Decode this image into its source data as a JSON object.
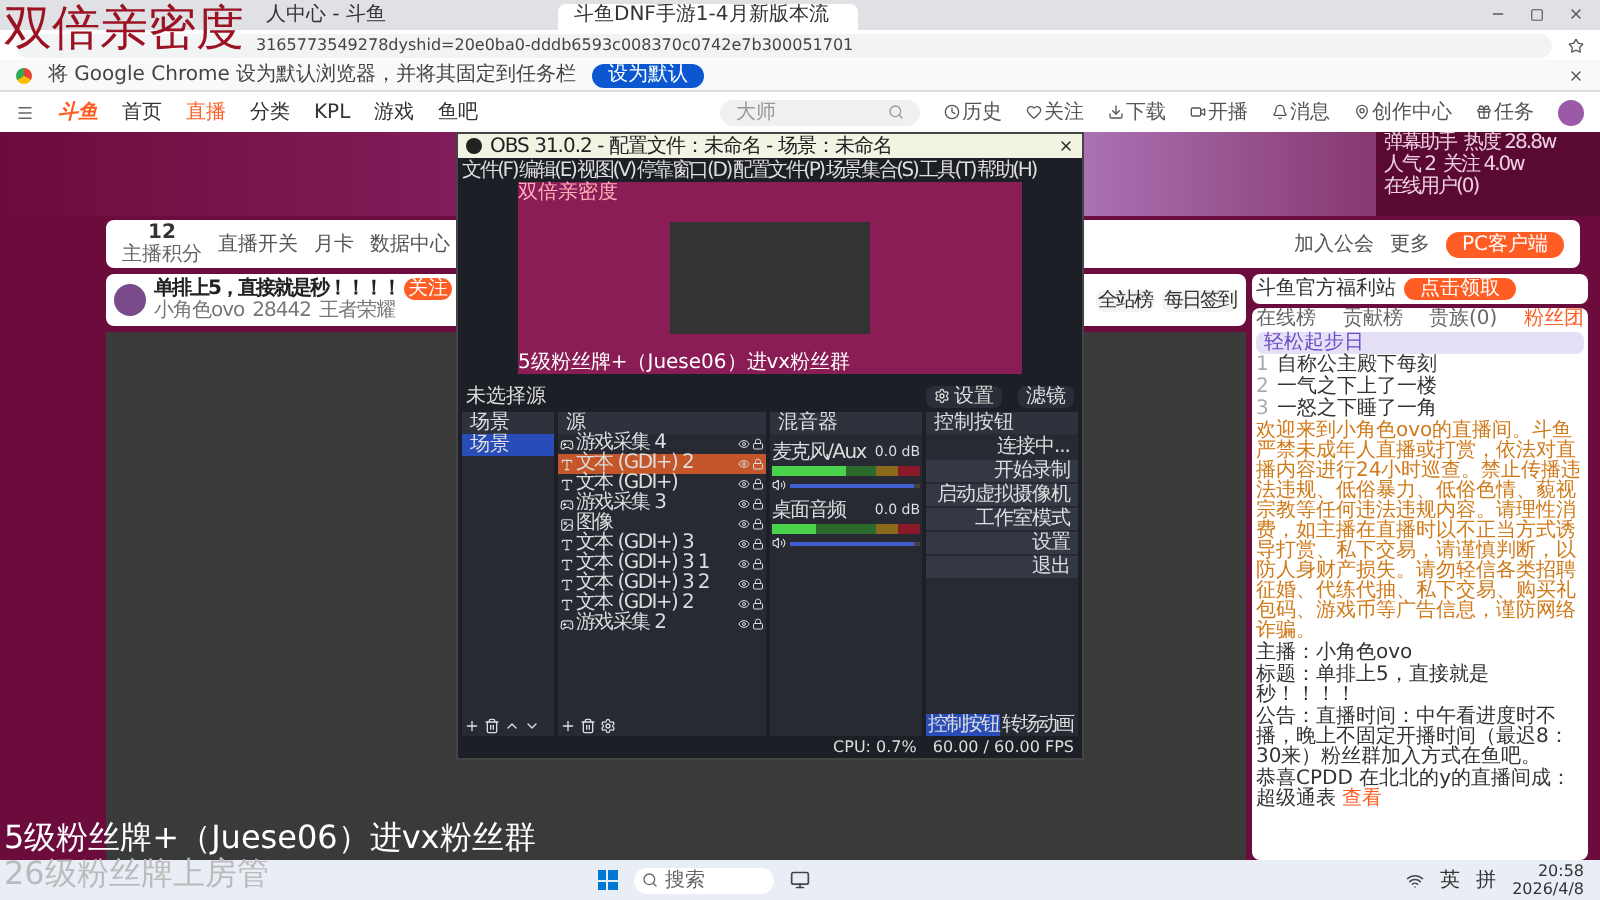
{
  "overlay": {
    "top_caption": "双倍亲密度",
    "bottom_caption": "5级粉丝牌+（Juese06）进vx粉丝群",
    "bottom_caption_2": "26级粉丝牌上房管"
  },
  "browser": {
    "tabs": [
      {
        "label": "人中心 - 斗鱼",
        "selected": false
      },
      {
        "label": "斗鱼DNF手游1-4月新版本流",
        "selected": true
      }
    ],
    "url": "3165773549278dyshid=20e0ba0-dddb6593c008370c0742e7b300051701",
    "infobar": {
      "text": "将 Google Chrome 设为默认浏览器，并将其固定到任务栏",
      "button": "设为默认"
    }
  },
  "site": {
    "logo": "斗鱼",
    "nav": [
      {
        "label": "首页",
        "selected": false
      },
      {
        "label": "直播",
        "selected": true
      },
      {
        "label": "分类",
        "selected": false
      },
      {
        "label": "KPL",
        "selected": false
      },
      {
        "label": "游戏",
        "selected": false
      },
      {
        "label": "鱼吧",
        "selected": false
      }
    ],
    "search": {
      "placeholder": "大师"
    },
    "header_icons": [
      {
        "label": "历史",
        "kind": "clock"
      },
      {
        "label": "关注",
        "kind": "heart"
      },
      {
        "label": "下载",
        "kind": "download"
      },
      {
        "label": "开播",
        "kind": "video"
      },
      {
        "label": "消息",
        "kind": "bell"
      },
      {
        "label": "创作中心",
        "kind": "pin"
      },
      {
        "label": "任务",
        "kind": "gift"
      }
    ]
  },
  "toolbar": {
    "points": "12",
    "points_label": "主播积分",
    "items_left": [
      "直播开关",
      "月卡",
      "数据中心"
    ],
    "items_right": [
      "加入公会",
      "更多"
    ],
    "pc_button": "PC客户端"
  },
  "room": {
    "title": "单排上5，直接就是秒！！！！",
    "follow": "关注",
    "streamer": "小角色ovo",
    "hot": "28442",
    "category": "王者荣耀",
    "rank_button": "全站榜",
    "checkin": "每日签到"
  },
  "promo": {
    "title": "斗鱼官方福利站",
    "button": "点击领取"
  },
  "chat": {
    "tabs": [
      {
        "label": "在线榜",
        "selected": false
      },
      {
        "label": "贡献榜",
        "selected": false
      },
      {
        "label": "贵族(0)",
        "selected": false
      },
      {
        "label": "粉丝团",
        "selected": true
      }
    ],
    "fan_badge": "轻松起步日",
    "ranks": [
      {
        "rank": "1",
        "name": "自称公主殿下每刻"
      },
      {
        "rank": "2",
        "name": "一气之下上了一楼"
      },
      {
        "rank": "3",
        "name": "一怒之下睡了一角"
      }
    ],
    "welcome": "欢迎来到小角色ovo的直播间。斗鱼严禁未成年人直播或打赏，依法对直播内容进行24小时巡查。禁止传播违法违规、低俗暴力、低俗色情、藐视宗教等任何违法违规内容。请理性消费，如主播在直播时以不正当方式诱导打赏、私下交易，请谨慎判断，以防人身财产损失。请勿轻信各类招聘征婚、代练代抽、私下交易、购买礼包码、游戏币等广告信息，谨防网络诈骗。",
    "info": [
      {
        "key": "主播：",
        "value": "小角色ovo"
      },
      {
        "key": "标题：",
        "value": "单排上5，直接就是秒！！！！"
      },
      {
        "key": "公告：",
        "value": "直播时间：中午看进度时不播，晚上不固定开播时间（最迟8：30来）粉丝群加入方式在鱼吧。"
      }
    ],
    "notice": "恭喜CPDD 在北北的y的直播间成：超级通表",
    "notice_link": "查看"
  },
  "side_stats": [
    "弹幕助手",
    "热度 28.8w",
    "人气 2",
    "关注 4.0w",
    "在线用户(0)"
  ],
  "obs": {
    "title": "OBS 31.0.2 - 配置文件：未命名 - 场景：未命名",
    "menu": [
      "文件(F)",
      "编辑(E)",
      "视图(V)",
      "停靠窗口(D)",
      "配置文件(P)",
      "场景集合(S)",
      "工具(T)",
      "帮助(H)"
    ],
    "preview_caption_top": "双倍亲密度",
    "preview_caption_bottom": "5级粉丝牌+（Juese06）进vx粉丝群",
    "no_source": "未选择源",
    "props_buttons": [
      "设置",
      "滤镜"
    ],
    "docks": {
      "scenes": "场景",
      "sources": "源",
      "mixer": "混音器",
      "controls": "控制按钮"
    },
    "scenes": [
      {
        "name": "场景",
        "selected": true
      }
    ],
    "sources": [
      {
        "name": "游戏采集 4",
        "kind": "game",
        "selected": false
      },
      {
        "name": "文本 (GDI+) 2",
        "kind": "text",
        "selected": true
      },
      {
        "name": "文本 (GDI+)",
        "kind": "text",
        "selected": false
      },
      {
        "name": "游戏采集 3",
        "kind": "game",
        "selected": false
      },
      {
        "name": "图像",
        "kind": "image",
        "selected": false
      },
      {
        "name": "文本 (GDI+) 3",
        "kind": "text",
        "selected": false
      },
      {
        "name": "文本 (GDI+) 3 1",
        "kind": "text",
        "selected": false
      },
      {
        "name": "文本 (GDI+) 3 2",
        "kind": "text",
        "selected": false
      },
      {
        "name": "文本 (GDI+) 2",
        "kind": "text",
        "selected": false
      },
      {
        "name": "游戏采集 2",
        "kind": "game",
        "selected": false
      }
    ],
    "mixer": [
      {
        "name": "麦克风/Aux",
        "reading": "0.0 dB",
        "level": 0.95,
        "meter": {
          "level": 0.5
        }
      },
      {
        "name": "桌面音频",
        "reading": "0.0 dB",
        "level": 0.95,
        "meter": {
          "level": 0.3
        }
      }
    ],
    "controls": [
      "连接中...",
      "开始录制",
      "启动虚拟摄像机",
      "工作室模式",
      "设置",
      "退出"
    ],
    "bottom_tabs": [
      {
        "label": "控制按钮",
        "selected": true
      },
      {
        "label": "转场动画",
        "selected": false
      }
    ],
    "status": [
      "CPU: 0.7%",
      "60.00 / 60.00 FPS"
    ]
  },
  "taskbar": {
    "search": "搜索",
    "tray": [
      "英",
      "拼"
    ],
    "time": "20:58",
    "date": "2026/4/8"
  }
}
